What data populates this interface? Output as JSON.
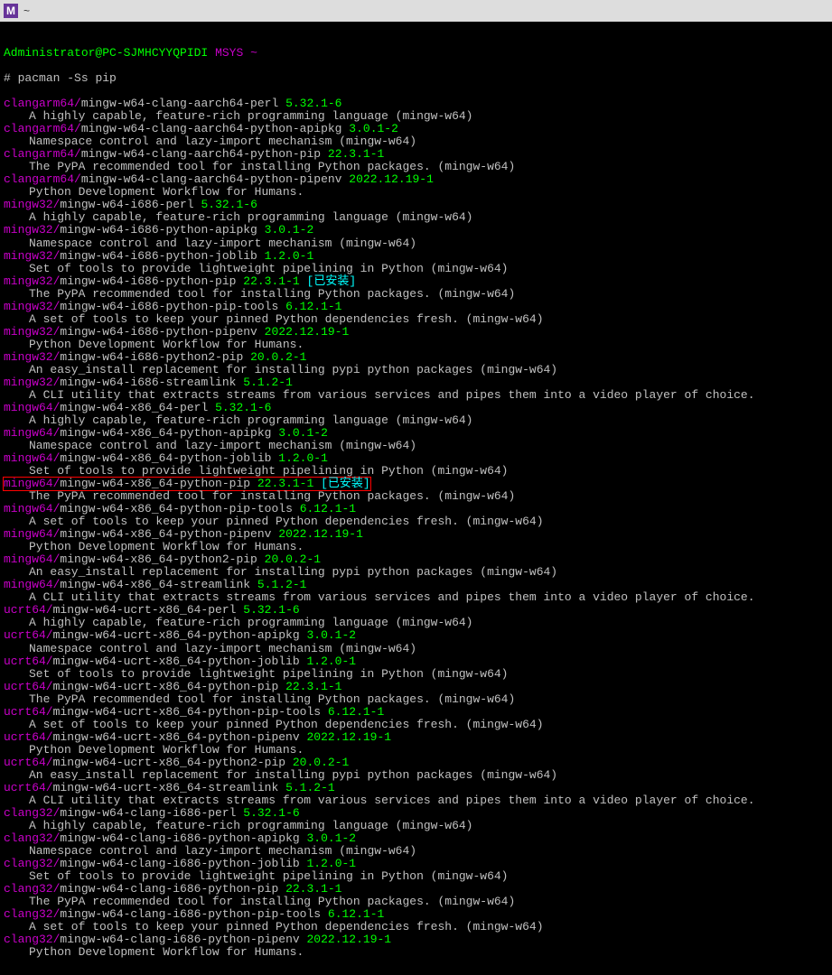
{
  "window": {
    "title": "~"
  },
  "prompt": {
    "user": "Administrator@PC-SJMHCYYQPIDI",
    "app": "MSYS",
    "path": "~",
    "symbol": "#",
    "command": "pacman -Ss pip"
  },
  "results": [
    {
      "repo": "clangarm64",
      "name": "mingw-w64-clang-aarch64-perl",
      "ver": "5.32.1-6",
      "desc": "A highly capable, feature-rich programming language (mingw-w64)"
    },
    {
      "repo": "clangarm64",
      "name": "mingw-w64-clang-aarch64-python-apipkg",
      "ver": "3.0.1-2",
      "desc": "Namespace control and lazy-import mechanism (mingw-w64)"
    },
    {
      "repo": "clangarm64",
      "name": "mingw-w64-clang-aarch64-python-pip",
      "ver": "22.3.1-1",
      "desc": "The PyPA recommended tool for installing Python packages. (mingw-w64)"
    },
    {
      "repo": "clangarm64",
      "name": "mingw-w64-clang-aarch64-python-pipenv",
      "ver": "2022.12.19-1",
      "desc": "Python Development Workflow for Humans."
    },
    {
      "repo": "mingw32",
      "name": "mingw-w64-i686-perl",
      "ver": "5.32.1-6",
      "desc": "A highly capable, feature-rich programming language (mingw-w64)"
    },
    {
      "repo": "mingw32",
      "name": "mingw-w64-i686-python-apipkg",
      "ver": "3.0.1-2",
      "desc": "Namespace control and lazy-import mechanism (mingw-w64)"
    },
    {
      "repo": "mingw32",
      "name": "mingw-w64-i686-python-joblib",
      "ver": "1.2.0-1",
      "desc": "Set of tools to provide lightweight pipelining in Python (mingw-w64)"
    },
    {
      "repo": "mingw32",
      "name": "mingw-w64-i686-python-pip",
      "ver": "22.3.1-1",
      "status": "[已安装]",
      "desc": "The PyPA recommended tool for installing Python packages. (mingw-w64)"
    },
    {
      "repo": "mingw32",
      "name": "mingw-w64-i686-python-pip-tools",
      "ver": "6.12.1-1",
      "desc": "A set of tools to keep your pinned Python dependencies fresh. (mingw-w64)"
    },
    {
      "repo": "mingw32",
      "name": "mingw-w64-i686-python-pipenv",
      "ver": "2022.12.19-1",
      "desc": "Python Development Workflow for Humans."
    },
    {
      "repo": "mingw32",
      "name": "mingw-w64-i686-python2-pip",
      "ver": "20.0.2-1",
      "desc": "An easy_install replacement for installing pypi python packages (mingw-w64)"
    },
    {
      "repo": "mingw32",
      "name": "mingw-w64-i686-streamlink",
      "ver": "5.1.2-1",
      "desc": "A CLI utility that extracts streams from various services and pipes them into a video player of choice."
    },
    {
      "repo": "mingw64",
      "name": "mingw-w64-x86_64-perl",
      "ver": "5.32.1-6",
      "desc": "A highly capable, feature-rich programming language (mingw-w64)"
    },
    {
      "repo": "mingw64",
      "name": "mingw-w64-x86_64-python-apipkg",
      "ver": "3.0.1-2",
      "desc": "Namespace control and lazy-import mechanism (mingw-w64)"
    },
    {
      "repo": "mingw64",
      "name": "mingw-w64-x86_64-python-joblib",
      "ver": "1.2.0-1",
      "desc": "Set of tools to provide lightweight pipelining in Python (mingw-w64)"
    },
    {
      "repo": "mingw64",
      "name": "mingw-w64-x86_64-python-pip",
      "ver": "22.3.1-1",
      "status": "[已安装]",
      "highlight": true,
      "desc": "The PyPA recommended tool for installing Python packages. (mingw-w64)"
    },
    {
      "repo": "mingw64",
      "name": "mingw-w64-x86_64-python-pip-tools",
      "ver": "6.12.1-1",
      "desc": "A set of tools to keep your pinned Python dependencies fresh. (mingw-w64)"
    },
    {
      "repo": "mingw64",
      "name": "mingw-w64-x86_64-python-pipenv",
      "ver": "2022.12.19-1",
      "desc": "Python Development Workflow for Humans."
    },
    {
      "repo": "mingw64",
      "name": "mingw-w64-x86_64-python2-pip",
      "ver": "20.0.2-1",
      "desc": "An easy_install replacement for installing pypi python packages (mingw-w64)"
    },
    {
      "repo": "mingw64",
      "name": "mingw-w64-x86_64-streamlink",
      "ver": "5.1.2-1",
      "desc": "A CLI utility that extracts streams from various services and pipes them into a video player of choice."
    },
    {
      "repo": "ucrt64",
      "name": "mingw-w64-ucrt-x86_64-perl",
      "ver": "5.32.1-6",
      "desc": "A highly capable, feature-rich programming language (mingw-w64)"
    },
    {
      "repo": "ucrt64",
      "name": "mingw-w64-ucrt-x86_64-python-apipkg",
      "ver": "3.0.1-2",
      "desc": "Namespace control and lazy-import mechanism (mingw-w64)"
    },
    {
      "repo": "ucrt64",
      "name": "mingw-w64-ucrt-x86_64-python-joblib",
      "ver": "1.2.0-1",
      "desc": "Set of tools to provide lightweight pipelining in Python (mingw-w64)"
    },
    {
      "repo": "ucrt64",
      "name": "mingw-w64-ucrt-x86_64-python-pip",
      "ver": "22.3.1-1",
      "desc": "The PyPA recommended tool for installing Python packages. (mingw-w64)"
    },
    {
      "repo": "ucrt64",
      "name": "mingw-w64-ucrt-x86_64-python-pip-tools",
      "ver": "6.12.1-1",
      "desc": "A set of tools to keep your pinned Python dependencies fresh. (mingw-w64)"
    },
    {
      "repo": "ucrt64",
      "name": "mingw-w64-ucrt-x86_64-python-pipenv",
      "ver": "2022.12.19-1",
      "desc": "Python Development Workflow for Humans."
    },
    {
      "repo": "ucrt64",
      "name": "mingw-w64-ucrt-x86_64-python2-pip",
      "ver": "20.0.2-1",
      "desc": "An easy_install replacement for installing pypi python packages (mingw-w64)"
    },
    {
      "repo": "ucrt64",
      "name": "mingw-w64-ucrt-x86_64-streamlink",
      "ver": "5.1.2-1",
      "desc": "A CLI utility that extracts streams from various services and pipes them into a video player of choice."
    },
    {
      "repo": "clang32",
      "name": "mingw-w64-clang-i686-perl",
      "ver": "5.32.1-6",
      "desc": "A highly capable, feature-rich programming language (mingw-w64)"
    },
    {
      "repo": "clang32",
      "name": "mingw-w64-clang-i686-python-apipkg",
      "ver": "3.0.1-2",
      "desc": "Namespace control and lazy-import mechanism (mingw-w64)"
    },
    {
      "repo": "clang32",
      "name": "mingw-w64-clang-i686-python-joblib",
      "ver": "1.2.0-1",
      "desc": "Set of tools to provide lightweight pipelining in Python (mingw-w64)"
    },
    {
      "repo": "clang32",
      "name": "mingw-w64-clang-i686-python-pip",
      "ver": "22.3.1-1",
      "desc": "The PyPA recommended tool for installing Python packages. (mingw-w64)"
    },
    {
      "repo": "clang32",
      "name": "mingw-w64-clang-i686-python-pip-tools",
      "ver": "6.12.1-1",
      "desc": "A set of tools to keep your pinned Python dependencies fresh. (mingw-w64)"
    },
    {
      "repo": "clang32",
      "name": "mingw-w64-clang-i686-python-pipenv",
      "ver": "2022.12.19-1",
      "desc": "Python Development Workflow for Humans."
    }
  ]
}
